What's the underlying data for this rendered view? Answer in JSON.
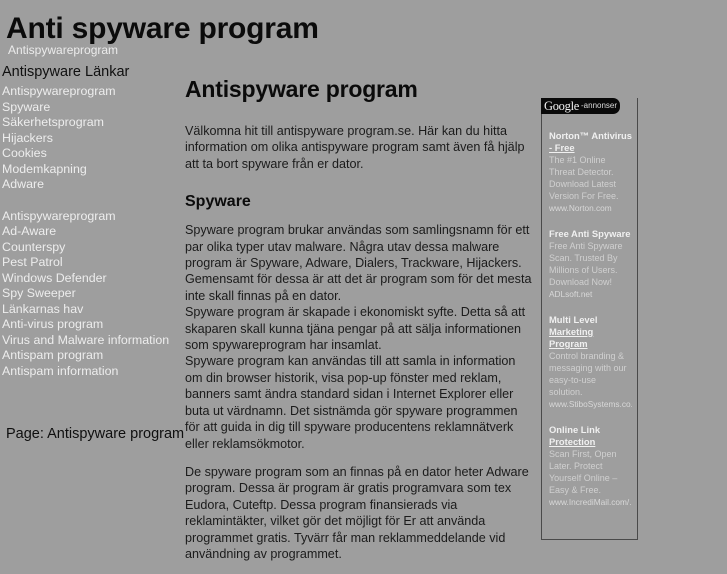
{
  "header": {
    "title": "Anti spyware program",
    "subtitle_link": "Antispywareprogram"
  },
  "sidebar": {
    "heading": "Antispyware Länkar",
    "group1": [
      {
        "label": "Antispywareprogram"
      },
      {
        "label": "Spyware"
      },
      {
        "label": "Säkerhetsprogram"
      },
      {
        "label": "Hijackers"
      },
      {
        "label": "Cookies"
      },
      {
        "label": "Modemkapning"
      },
      {
        "label": "Adware"
      }
    ],
    "group2": [
      {
        "label": "Antispywareprogram"
      },
      {
        "label": "Ad-Aware"
      },
      {
        "label": "Counterspy"
      },
      {
        "label": "Pest Patrol"
      },
      {
        "label": "Windows Defender"
      },
      {
        "label": "Spy Sweeper"
      },
      {
        "label": "Länkarnas hav"
      },
      {
        "label": "Anti-virus program"
      },
      {
        "label": "Virus and Malware information"
      },
      {
        "label": "Antispam program"
      },
      {
        "label": "Antispam information"
      }
    ],
    "page_label": "Page: Antispyware program"
  },
  "main": {
    "title": "Antispyware program",
    "intro": "Välkomna hit till antispyware program.se. Här kan du hitta information om olika antispyware program samt även få hjälp att ta bort spyware från er dator.",
    "section_heading": "Spyware",
    "paragraph1": "Spyware program brukar användas som samlingsnamn för ett par olika typer utav malware. Några utav dessa malware program är Spyware, Adware, Dialers, Trackware, Hijackers.",
    "paragraph2": "Gemensamt för dessa är att det är program som för det mesta inte skall finnas på en dator.",
    "paragraph3": "Spyware program är skapade i ekonomiskt syfte. Detta så att skaparen skall kunna tjäna pengar på att sälja informationen som spywareprogram har insamlat.",
    "paragraph4": "Spyware program kan användas till att samla in information om din browser historik, visa pop-up fönster med reklam, banners samt ändra standard sidan i Internet Explorer eller buta ut värdnamn. Det sistnämda gör spyware programmen för att guida in dig till spyware producentens reklamnätverk eller reklamsökmotor.",
    "paragraph5": "De spyware program som an finnas på en dator heter Adware program. Dessa är program är gratis programvara som tex Eudora, Cuteftp. Dessa program finansierads via reklamintäkter, vilket gör det möjligt för Er att använda programmet gratis. Tyvärr får man reklammeddelande vid användning av programmet."
  },
  "ads": {
    "logo_text": "Google",
    "label": "-annonser",
    "items": [
      {
        "title_line1": "Norton™ Antivirus",
        "title_line2": "- Free",
        "desc": "The #1 Online Threat Detector. Download Latest Version For Free.",
        "url": "www.Norton.com"
      },
      {
        "title_line1": "Free Anti Spyware",
        "title_line2": "",
        "desc": "Free Anti Spyware Scan. Trusted By Millions of Users. Download Now!",
        "url": "ADLsoft.net"
      },
      {
        "title_line1": "Multi Level",
        "title_line2": "Marketing Program",
        "desc": "Control branding & messaging with our easy-to-use solution.",
        "url": "www.StiboSystems.co..."
      },
      {
        "title_line1": "Online Link",
        "title_line2": "Protection",
        "desc": "Scan First, Open Later. Protect Yourself Online – Easy & Free.",
        "url": "www.IncrediMail.com/..."
      }
    ]
  },
  "colors": {
    "page_background": "#9e9e9e",
    "link": "#ededed",
    "text": "#1b1b1b",
    "ads_header_bg": "#0a0a0a"
  }
}
